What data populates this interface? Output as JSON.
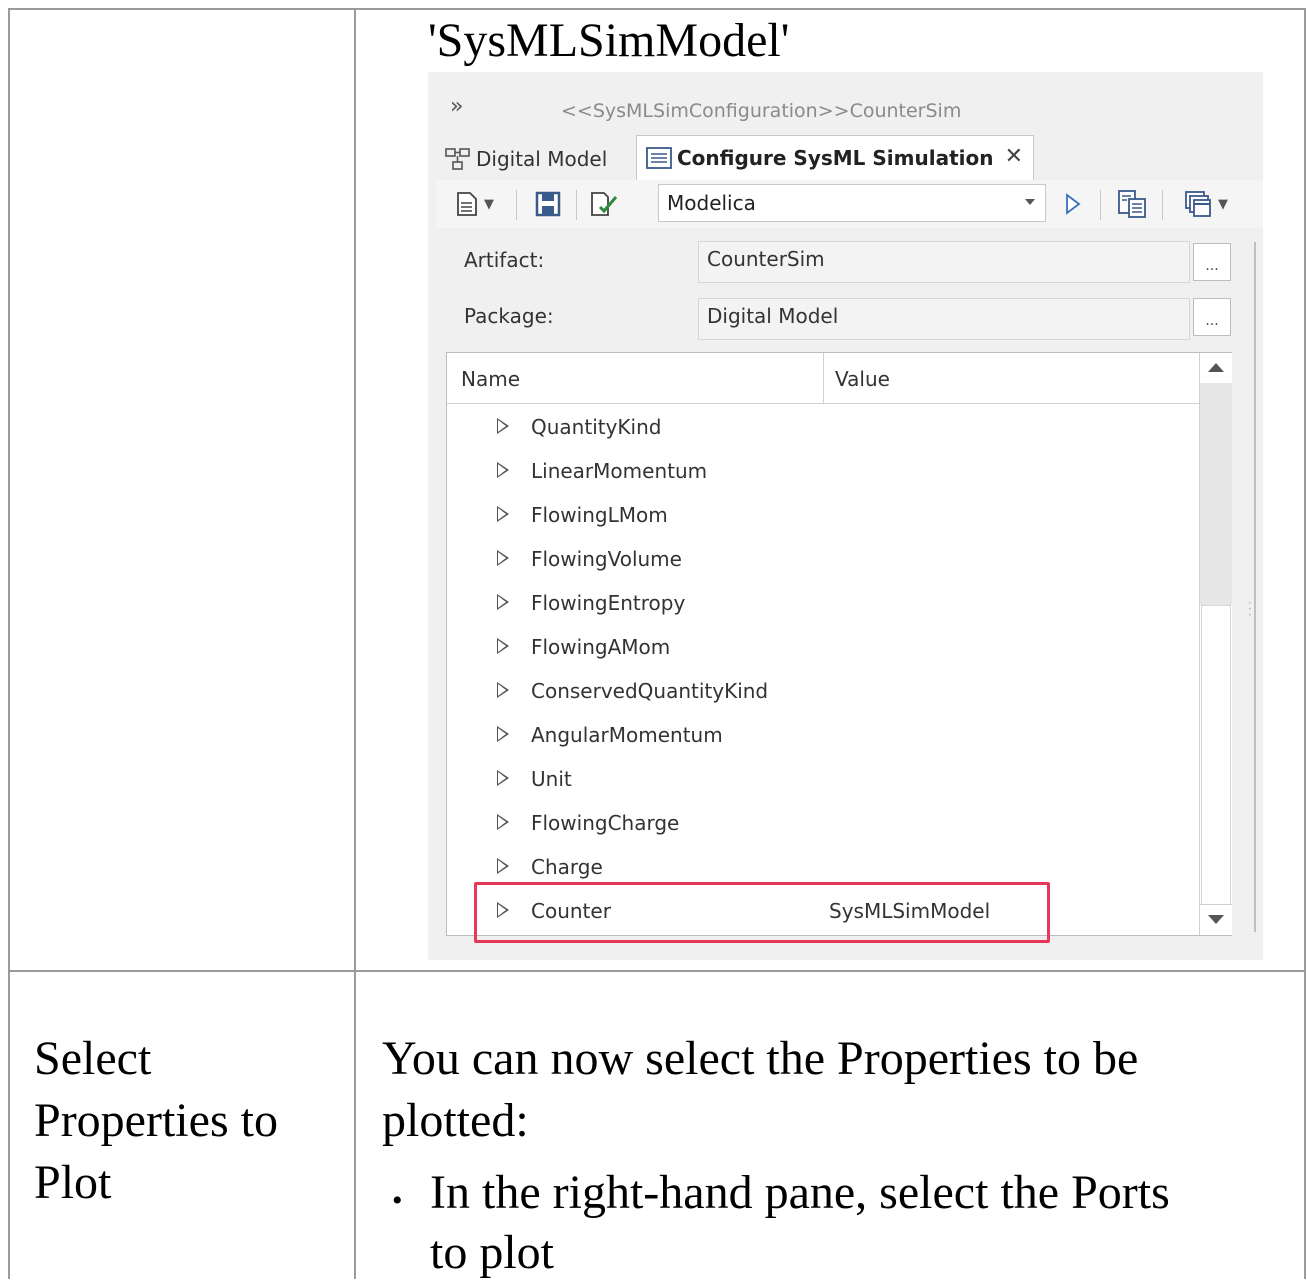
{
  "top_caption": "'SysMLSimModel'",
  "screenshot": {
    "panel_title": "<<SysMLSimConfiguration>>CounterSim",
    "tabs": [
      {
        "label": "Digital Model",
        "active": false,
        "icon": "diagram-icon"
      },
      {
        "label": "Configure SysML Simulation",
        "active": true,
        "icon": "document-icon"
      }
    ],
    "toolbar": {
      "language": "Modelica"
    },
    "artifact": {
      "label": "Artifact:",
      "value": "CounterSim",
      "button": "..."
    },
    "package": {
      "label": "Package:",
      "value": "Digital Model",
      "button": "..."
    },
    "grid": {
      "columns": [
        "Name",
        "Value"
      ],
      "rows": [
        {
          "name": "QuantityKind",
          "value": ""
        },
        {
          "name": "LinearMomentum",
          "value": ""
        },
        {
          "name": "FlowingLMom",
          "value": ""
        },
        {
          "name": "FlowingVolume",
          "value": ""
        },
        {
          "name": "FlowingEntropy",
          "value": ""
        },
        {
          "name": "FlowingAMom",
          "value": ""
        },
        {
          "name": "ConservedQuantityKind",
          "value": ""
        },
        {
          "name": "AngularMomentum",
          "value": ""
        },
        {
          "name": "Unit",
          "value": ""
        },
        {
          "name": "FlowingCharge",
          "value": ""
        },
        {
          "name": "Charge",
          "value": ""
        },
        {
          "name": "Counter",
          "value": "SysMLSimModel"
        }
      ]
    },
    "colors": {
      "highlight": "#e8385a",
      "toolbar_icon": "#3a5a8a"
    }
  },
  "step": {
    "title_lines": [
      "Select",
      "Properties to",
      "Plot"
    ],
    "description_lines": [
      "You can now select the Properties to be",
      "plotted:"
    ],
    "bullet_lines": [
      "In the right-hand pane, select the Ports",
      "to plot"
    ]
  }
}
